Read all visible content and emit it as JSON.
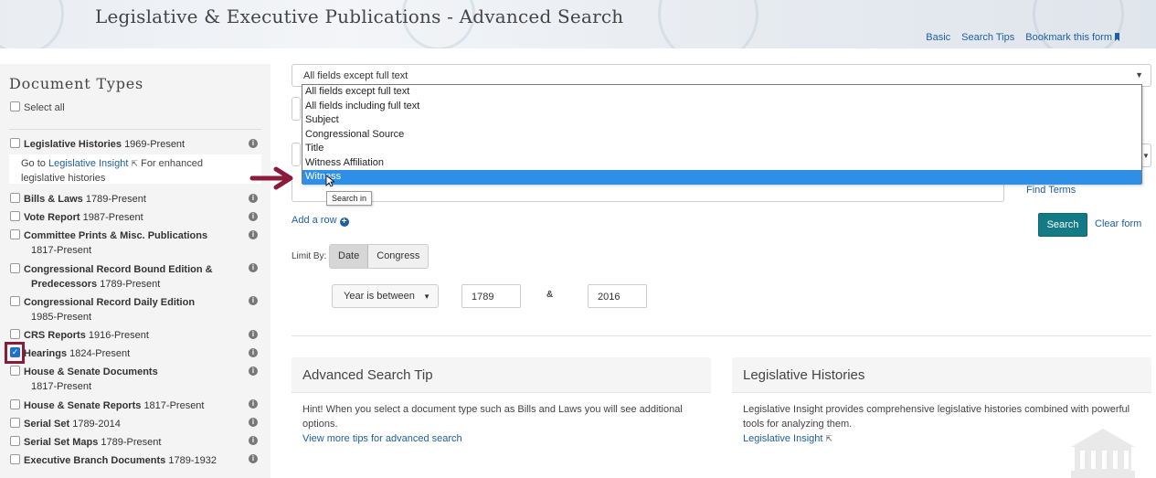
{
  "header": {
    "title": "Legislative & Executive Publications - Advanced Search",
    "links": [
      "Basic",
      "Search Tips",
      "Bookmark this form"
    ]
  },
  "sidebar": {
    "title": "Document Types",
    "select_all": "Select all",
    "items": [
      {
        "name": "Legislative Histories",
        "range": "1969-Present"
      },
      {
        "name": "Bills & Laws",
        "range": "1789-Present"
      },
      {
        "name": "Vote Report",
        "range": "1987-Present"
      },
      {
        "name": "Committee Prints & Misc. Publications",
        "range": "1817-Present"
      },
      {
        "name": "Congressional Record Bound Edition &",
        "name2": "Predecessors",
        "range": "1789-Present"
      },
      {
        "name": "Congressional Record Daily Edition",
        "range": "1985-Present"
      },
      {
        "name": "CRS Reports",
        "range": "1916-Present"
      },
      {
        "name": "Hearings",
        "range": "1824-Present",
        "checked": true
      },
      {
        "name": "House & Senate Documents",
        "range": "1817-Present"
      },
      {
        "name": "House & Senate Reports",
        "range": "1817-Present"
      },
      {
        "name": "Serial Set",
        "range": "1789-2014"
      },
      {
        "name": "Serial Set Maps",
        "range": "1789-Present"
      },
      {
        "name": "Executive Branch Documents",
        "range": "1789-1932"
      }
    ],
    "li_note": {
      "prefix": "Go to",
      "link": "Legislative Insight",
      "suffix": "For enhanced",
      "line2": "legislative histories"
    }
  },
  "search": {
    "field_select": "All fields except full text",
    "options": [
      "All fields except full text",
      "All fields including full text",
      "Subject",
      "Congressional Source",
      "Title",
      "Witness Affiliation",
      "Witness"
    ],
    "selected_option": "Witness",
    "tooltip": "Search in",
    "find_terms": "Find Terms",
    "add_row": "Add a row",
    "search_button": "Search",
    "clear_form": "Clear form"
  },
  "limit": {
    "label": "Limit By:",
    "tabs": [
      "Date",
      "Congress"
    ],
    "active_tab": "Date",
    "range_select": "Year is between",
    "from": "1789",
    "amp": "&",
    "to": "2016"
  },
  "panels": {
    "tip": {
      "title": "Advanced Search Tip",
      "text": "Hint! When you select a document type such as Bills and Laws you will see additional options.",
      "link": "View more tips for advanced search"
    },
    "histories": {
      "title": "Legislative Histories",
      "text": "Legislative Insight provides comprehensive legislative histories combined with powerful tools for analyzing them.",
      "link": "Legislative Insight"
    }
  },
  "colors": {
    "link": "#1f5fa0",
    "search_button": "#147a86",
    "highlight": "#8a1b3a",
    "dropdown_selected": "#2f8fe6"
  }
}
